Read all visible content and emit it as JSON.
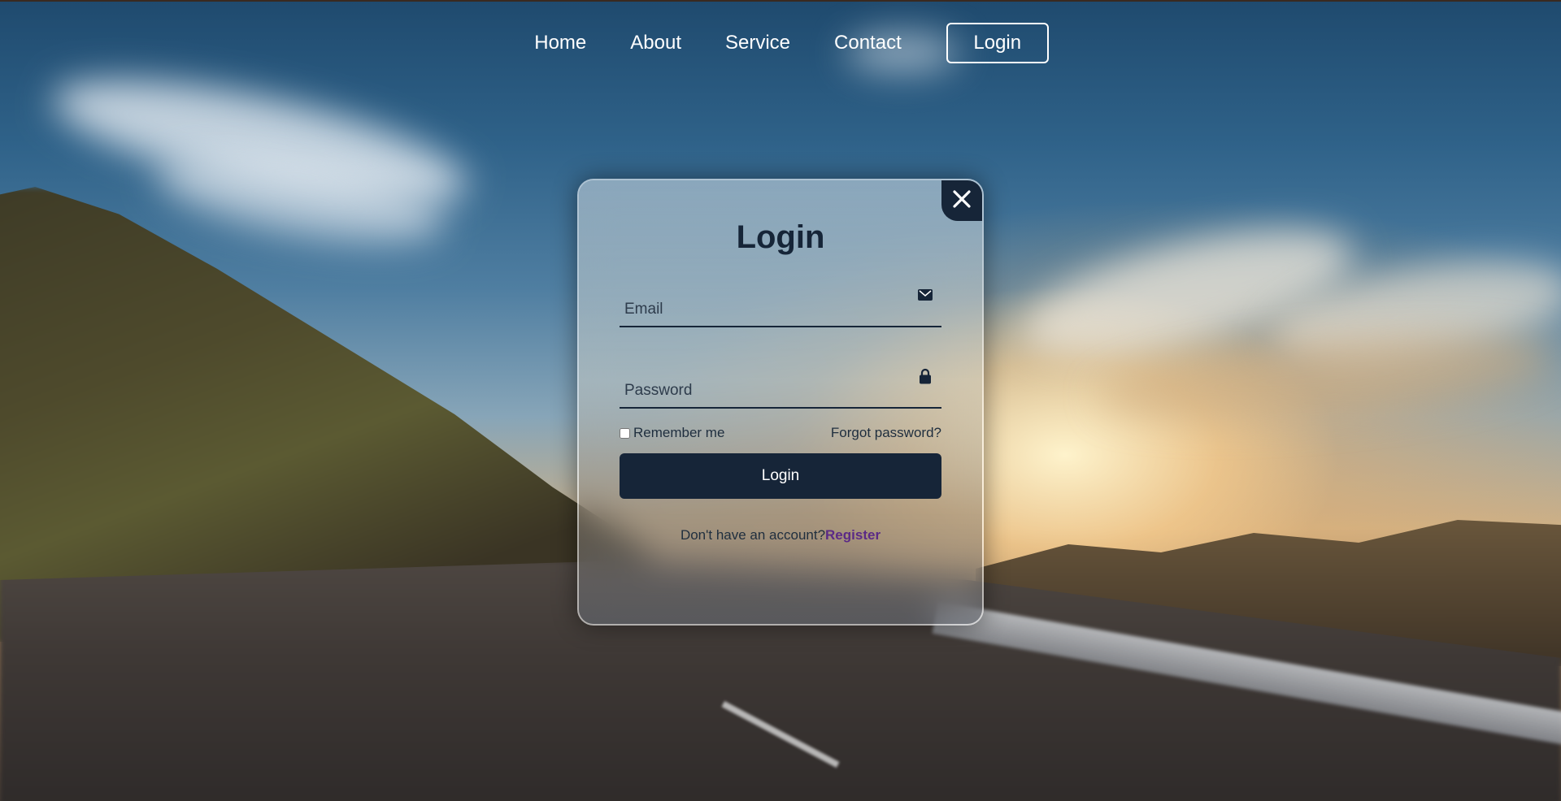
{
  "nav": {
    "links": [
      {
        "label": "Home"
      },
      {
        "label": "About"
      },
      {
        "label": "Service"
      },
      {
        "label": "Contact"
      }
    ],
    "login_button": "Login"
  },
  "login_form": {
    "title": "Login",
    "email": {
      "placeholder": "Email",
      "value": "",
      "icon": "mail-icon"
    },
    "password": {
      "placeholder": "Password",
      "value": "",
      "icon": "lock-icon"
    },
    "remember_label": "Remember me",
    "remember_checked": false,
    "forgot_label": "Forgot password?",
    "submit_label": "Login",
    "register_prompt": "Don't have an account?",
    "register_link": "Register",
    "close_icon": "close-icon"
  },
  "colors": {
    "primary": "#162538",
    "register_link": "#5b2a86",
    "nav_text": "#ffffff"
  }
}
